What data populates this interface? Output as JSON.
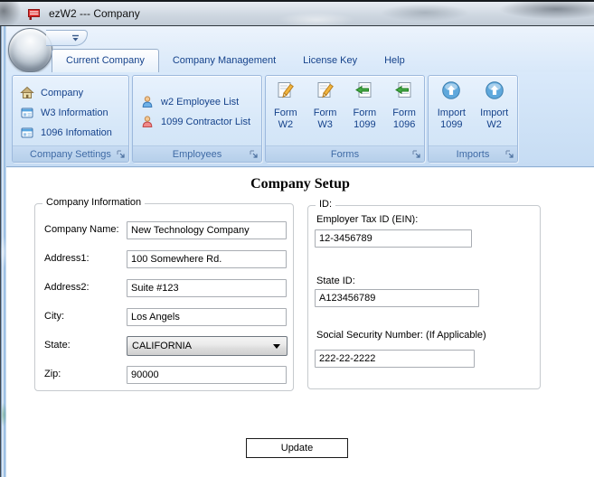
{
  "window": {
    "title": "ezW2 --- Company"
  },
  "tabs": {
    "items": [
      {
        "label": "Current Company",
        "active": true
      },
      {
        "label": "Company Management",
        "active": false
      },
      {
        "label": "License Key",
        "active": false
      },
      {
        "label": "Help",
        "active": false
      }
    ]
  },
  "ribbon": {
    "groups": [
      {
        "caption": "Company Settings",
        "items": [
          {
            "label": "Company",
            "icon": "home-icon"
          },
          {
            "label": "W3 Information",
            "icon": "form-window-icon"
          },
          {
            "label": "1096 Infomation",
            "icon": "form-window-icon"
          }
        ]
      },
      {
        "caption": "Employees",
        "items": [
          {
            "label": "w2 Employee List",
            "icon": "person-blue-icon"
          },
          {
            "label": "1099 Contractor List",
            "icon": "person-red-icon"
          }
        ]
      },
      {
        "caption": "Forms",
        "buttons": [
          {
            "line1": "Form",
            "line2": "W2",
            "icon": "document-edit-icon"
          },
          {
            "line1": "Form",
            "line2": "W3",
            "icon": "document-edit-icon"
          },
          {
            "line1": "Form",
            "line2": "1099",
            "icon": "document-arrow-icon"
          },
          {
            "line1": "Form",
            "line2": "1096",
            "icon": "document-arrow-icon"
          }
        ]
      },
      {
        "caption": "Imports",
        "buttons": [
          {
            "line1": "Import",
            "line2": "1099",
            "icon": "import-circle-icon"
          },
          {
            "line1": "Import",
            "line2": "W2",
            "icon": "import-circle-icon"
          }
        ]
      }
    ]
  },
  "main": {
    "heading": "Company Setup",
    "company_info": {
      "legend": "Company Information",
      "company_name": {
        "label": "Company Name:",
        "value": "New Technology Company"
      },
      "address1": {
        "label": "Address1:",
        "value": "100 Somewhere Rd."
      },
      "address2": {
        "label": "Address2:",
        "value": "Suite #123"
      },
      "city": {
        "label": "City:",
        "value": "Los Angels"
      },
      "state": {
        "label": "State:",
        "value": "CALIFORNIA"
      },
      "zip": {
        "label": "Zip:",
        "value": "90000"
      }
    },
    "ids": {
      "legend": "ID:",
      "ein": {
        "label": "Employer Tax ID (EIN):",
        "value": "12-3456789"
      },
      "state_id": {
        "label": "State ID:",
        "value": "A123456789"
      },
      "ssn": {
        "label": "Social Security Number: (If Applicable)",
        "value": "222-22-2222"
      }
    },
    "update_label": "Update"
  },
  "colors": {
    "ribbon_text": "#15428b",
    "group_caption_text": "#3e6aa5",
    "app_icon_red": "#d62a2a",
    "ribbon_background": "#cde0f4",
    "client_background": "#ffffff"
  }
}
